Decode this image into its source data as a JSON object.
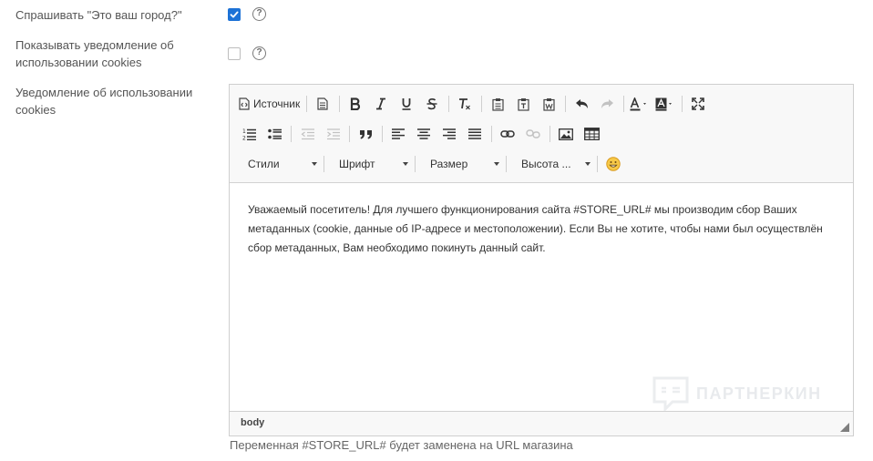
{
  "settings": {
    "ask_city_label": "Спрашивать \"Это ваш город?\"",
    "ask_city_checked": true,
    "show_cookies_label": "Показывать уведомление об использовании cookies",
    "show_cookies_checked": false,
    "cookie_notice_label": "Уведомление об использовании cookies",
    "help_glyph": "?"
  },
  "editor": {
    "toolbar": {
      "source_label": "Источник",
      "styles_label": "Стили",
      "font_label": "Шрифт",
      "size_label": "Размер",
      "height_label": "Высота ..."
    },
    "content_text": "Уважаемый посетитель! Для лучшего функционирования сайта #STORE_URL# мы производим сбор Ваших метаданных (cookie, данные об IP-адресе и местоположении). Если Вы не хотите, чтобы нами был осуществлён сбор метаданных, Вам необходимо покинуть данный сайт.",
    "element_path": "body"
  },
  "watermark": {
    "text": "ПАРТНЕРКИН"
  },
  "hint_text": "Переменная #STORE_URL# будет заменена на URL магазина",
  "colors": {
    "accent": "#1d72d6"
  },
  "icons": [
    "checkmark-icon",
    "help-icon",
    "source-icon",
    "document-icon",
    "bold-icon",
    "italic-icon",
    "underline-icon",
    "strikethrough-icon",
    "remove-format-icon",
    "paste-icon",
    "paste-text-icon",
    "paste-word-icon",
    "undo-icon",
    "redo-icon",
    "text-color-icon",
    "background-color-icon",
    "maximize-icon",
    "numbered-list-icon",
    "bulleted-list-icon",
    "decrease-indent-icon",
    "increase-indent-icon",
    "blockquote-icon",
    "align-left-icon",
    "align-center-icon",
    "align-right-icon",
    "justify-icon",
    "link-icon",
    "unlink-icon",
    "image-icon",
    "table-icon",
    "emoji-icon",
    "resize-handle-icon"
  ]
}
